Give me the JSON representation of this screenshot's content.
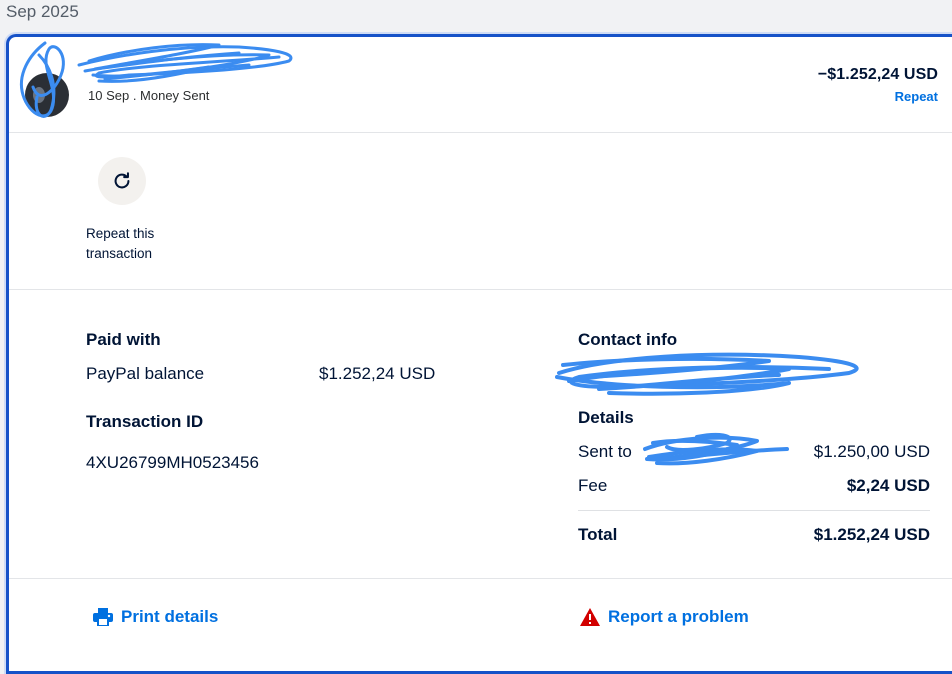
{
  "month_header": "Sep 2025",
  "transaction": {
    "merchant_name": "",
    "date_type": "10 Sep . Money Sent",
    "amount": "−$1.252,24 USD",
    "repeat_link": "Repeat"
  },
  "action": {
    "repeat_label": "Repeat this transaction",
    "icon": "refresh-icon"
  },
  "paid_with": {
    "heading": "Paid with",
    "method": "PayPal balance",
    "amount": "$1.252,24 USD"
  },
  "transaction_id": {
    "heading": "Transaction ID",
    "value": "4XU26799MH0523456"
  },
  "contact_info": {
    "heading": "Contact info"
  },
  "details": {
    "heading": "Details",
    "sent_to_label": "Sent to",
    "sent_to_amount": "$1.250,00 USD",
    "fee_label": "Fee",
    "fee_amount": "$2,24 USD",
    "total_label": "Total",
    "total_amount": "$1.252,24 USD"
  },
  "footer": {
    "print_label": "Print details",
    "print_icon": "printer-icon",
    "report_label": "Report a problem",
    "report_icon": "warning-icon"
  },
  "colors": {
    "link": "#0070e0",
    "border": "#1652c8",
    "scribble": "#3b8cf0",
    "warning": "#d20000"
  }
}
